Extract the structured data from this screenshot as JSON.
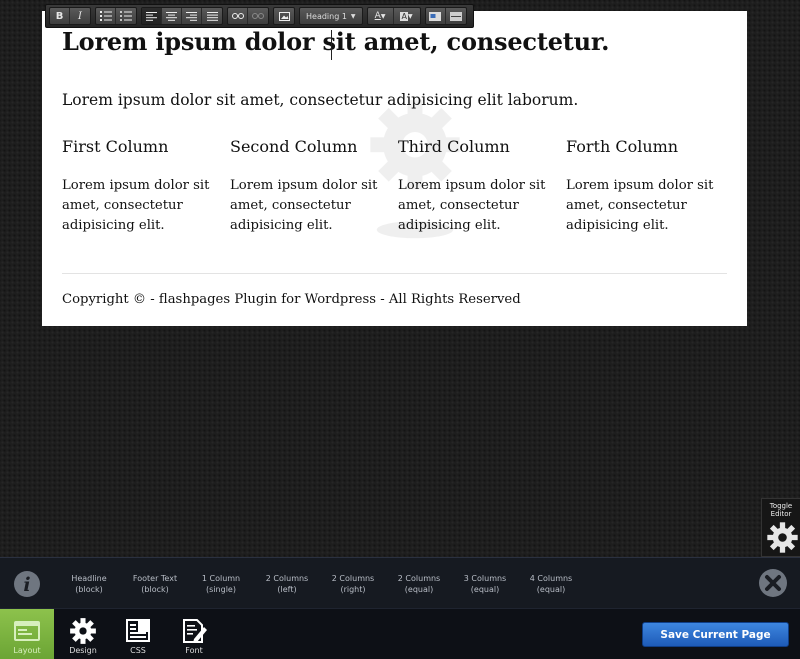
{
  "page": {
    "heading": "Lorem ipsum dolor sit amet, consectetur.",
    "lead": "Lorem ipsum dolor sit amet, consectetur adipisicing elit laborum.",
    "columns": [
      {
        "title": "First Column",
        "text": "Lorem ipsum dolor sit amet, consectetur adipisicing elit."
      },
      {
        "title": "Second Column",
        "text": "Lorem ipsum dolor sit amet, consectetur adipisicing elit."
      },
      {
        "title": "Third Column",
        "text": "Lorem ipsum dolor sit amet, consectetur adipisicing elit."
      },
      {
        "title": "Forth Column",
        "text": "Lorem ipsum dolor sit amet, consectetur adipisicing elit."
      }
    ],
    "footer": "Copyright © - flashpages Plugin for Wordpress - All Rights Reserved"
  },
  "toolbar": {
    "bold": "B",
    "italic": "I",
    "format_select": "Heading 1",
    "text_color": "A",
    "bg_color": "A",
    "icons": [
      "bold-icon",
      "italic-icon",
      "ordered-list-icon",
      "unordered-list-icon",
      "align-left-icon",
      "align-center-icon",
      "align-right-icon",
      "align-justify-icon",
      "link-icon",
      "unlink-icon",
      "image-icon",
      "text-color-icon",
      "background-color-icon",
      "media-icon",
      "horizontal-rule-icon"
    ]
  },
  "toggle_editor": {
    "line1": "Toggle",
    "line2": "Editor"
  },
  "layout_bar": {
    "items": [
      {
        "line1": "Headline",
        "line2": "(block)"
      },
      {
        "line1": "Footer Text",
        "line2": "(block)"
      },
      {
        "line1": "1 Column",
        "line2": "(single)"
      },
      {
        "line1": "2 Columns",
        "line2": "(left)"
      },
      {
        "line1": "2 Columns",
        "line2": "(right)"
      },
      {
        "line1": "2 Columns",
        "line2": "(equal)"
      },
      {
        "line1": "3 Columns",
        "line2": "(equal)"
      },
      {
        "line1": "4 Columns",
        "line2": "(equal)"
      }
    ],
    "icons": [
      "info-icon",
      "close-icon"
    ]
  },
  "bottom_bar": {
    "tools": [
      {
        "label": "Layout",
        "icon": "layout-icon",
        "active": true
      },
      {
        "label": "Design",
        "icon": "gear-icon"
      },
      {
        "label": "CSS",
        "icon": "css-icon"
      },
      {
        "label": "Font",
        "icon": "font-icon"
      }
    ],
    "save_label": "Save Current Page"
  },
  "colors": {
    "accent_green": "#7bb540",
    "save_blue": "#2a6fcf",
    "background": "#1e1e1e"
  }
}
